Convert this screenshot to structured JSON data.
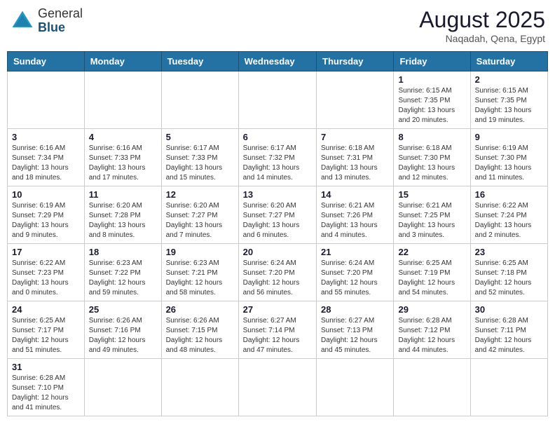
{
  "header": {
    "logo_general": "General",
    "logo_blue": "Blue",
    "month": "August 2025",
    "location": "Naqadah, Qena, Egypt"
  },
  "days_of_week": [
    "Sunday",
    "Monday",
    "Tuesday",
    "Wednesday",
    "Thursday",
    "Friday",
    "Saturday"
  ],
  "weeks": [
    [
      {
        "day": "",
        "info": ""
      },
      {
        "day": "",
        "info": ""
      },
      {
        "day": "",
        "info": ""
      },
      {
        "day": "",
        "info": ""
      },
      {
        "day": "",
        "info": ""
      },
      {
        "day": "1",
        "info": "Sunrise: 6:15 AM\nSunset: 7:35 PM\nDaylight: 13 hours and 20 minutes."
      },
      {
        "day": "2",
        "info": "Sunrise: 6:15 AM\nSunset: 7:35 PM\nDaylight: 13 hours and 19 minutes."
      }
    ],
    [
      {
        "day": "3",
        "info": "Sunrise: 6:16 AM\nSunset: 7:34 PM\nDaylight: 13 hours and 18 minutes."
      },
      {
        "day": "4",
        "info": "Sunrise: 6:16 AM\nSunset: 7:33 PM\nDaylight: 13 hours and 17 minutes."
      },
      {
        "day": "5",
        "info": "Sunrise: 6:17 AM\nSunset: 7:33 PM\nDaylight: 13 hours and 15 minutes."
      },
      {
        "day": "6",
        "info": "Sunrise: 6:17 AM\nSunset: 7:32 PM\nDaylight: 13 hours and 14 minutes."
      },
      {
        "day": "7",
        "info": "Sunrise: 6:18 AM\nSunset: 7:31 PM\nDaylight: 13 hours and 13 minutes."
      },
      {
        "day": "8",
        "info": "Sunrise: 6:18 AM\nSunset: 7:30 PM\nDaylight: 13 hours and 12 minutes."
      },
      {
        "day": "9",
        "info": "Sunrise: 6:19 AM\nSunset: 7:30 PM\nDaylight: 13 hours and 11 minutes."
      }
    ],
    [
      {
        "day": "10",
        "info": "Sunrise: 6:19 AM\nSunset: 7:29 PM\nDaylight: 13 hours and 9 minutes."
      },
      {
        "day": "11",
        "info": "Sunrise: 6:20 AM\nSunset: 7:28 PM\nDaylight: 13 hours and 8 minutes."
      },
      {
        "day": "12",
        "info": "Sunrise: 6:20 AM\nSunset: 7:27 PM\nDaylight: 13 hours and 7 minutes."
      },
      {
        "day": "13",
        "info": "Sunrise: 6:20 AM\nSunset: 7:27 PM\nDaylight: 13 hours and 6 minutes."
      },
      {
        "day": "14",
        "info": "Sunrise: 6:21 AM\nSunset: 7:26 PM\nDaylight: 13 hours and 4 minutes."
      },
      {
        "day": "15",
        "info": "Sunrise: 6:21 AM\nSunset: 7:25 PM\nDaylight: 13 hours and 3 minutes."
      },
      {
        "day": "16",
        "info": "Sunrise: 6:22 AM\nSunset: 7:24 PM\nDaylight: 13 hours and 2 minutes."
      }
    ],
    [
      {
        "day": "17",
        "info": "Sunrise: 6:22 AM\nSunset: 7:23 PM\nDaylight: 13 hours and 0 minutes."
      },
      {
        "day": "18",
        "info": "Sunrise: 6:23 AM\nSunset: 7:22 PM\nDaylight: 12 hours and 59 minutes."
      },
      {
        "day": "19",
        "info": "Sunrise: 6:23 AM\nSunset: 7:21 PM\nDaylight: 12 hours and 58 minutes."
      },
      {
        "day": "20",
        "info": "Sunrise: 6:24 AM\nSunset: 7:20 PM\nDaylight: 12 hours and 56 minutes."
      },
      {
        "day": "21",
        "info": "Sunrise: 6:24 AM\nSunset: 7:20 PM\nDaylight: 12 hours and 55 minutes."
      },
      {
        "day": "22",
        "info": "Sunrise: 6:25 AM\nSunset: 7:19 PM\nDaylight: 12 hours and 54 minutes."
      },
      {
        "day": "23",
        "info": "Sunrise: 6:25 AM\nSunset: 7:18 PM\nDaylight: 12 hours and 52 minutes."
      }
    ],
    [
      {
        "day": "24",
        "info": "Sunrise: 6:25 AM\nSunset: 7:17 PM\nDaylight: 12 hours and 51 minutes."
      },
      {
        "day": "25",
        "info": "Sunrise: 6:26 AM\nSunset: 7:16 PM\nDaylight: 12 hours and 49 minutes."
      },
      {
        "day": "26",
        "info": "Sunrise: 6:26 AM\nSunset: 7:15 PM\nDaylight: 12 hours and 48 minutes."
      },
      {
        "day": "27",
        "info": "Sunrise: 6:27 AM\nSunset: 7:14 PM\nDaylight: 12 hours and 47 minutes."
      },
      {
        "day": "28",
        "info": "Sunrise: 6:27 AM\nSunset: 7:13 PM\nDaylight: 12 hours and 45 minutes."
      },
      {
        "day": "29",
        "info": "Sunrise: 6:28 AM\nSunset: 7:12 PM\nDaylight: 12 hours and 44 minutes."
      },
      {
        "day": "30",
        "info": "Sunrise: 6:28 AM\nSunset: 7:11 PM\nDaylight: 12 hours and 42 minutes."
      }
    ],
    [
      {
        "day": "31",
        "info": "Sunrise: 6:28 AM\nSunset: 7:10 PM\nDaylight: 12 hours and 41 minutes."
      },
      {
        "day": "",
        "info": ""
      },
      {
        "day": "",
        "info": ""
      },
      {
        "day": "",
        "info": ""
      },
      {
        "day": "",
        "info": ""
      },
      {
        "day": "",
        "info": ""
      },
      {
        "day": "",
        "info": ""
      }
    ]
  ]
}
